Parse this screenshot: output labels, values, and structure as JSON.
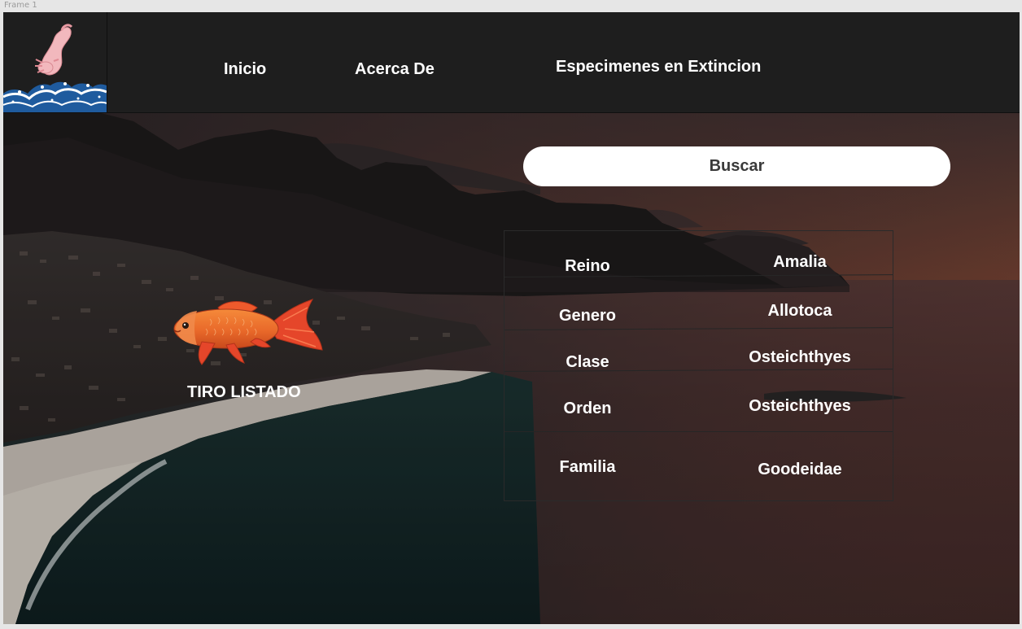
{
  "frame": {
    "label": "Frame 1"
  },
  "header": {
    "logo_icon": "axolotl-wave-logo",
    "nav": {
      "inicio": "Inicio",
      "acerca": "Acerca De",
      "especimenes": "Especimenes en Extincion"
    }
  },
  "search": {
    "label": "Buscar"
  },
  "specimen": {
    "name": "TIRO LISTADO",
    "image_icon": "goldfish-image",
    "taxonomy": [
      {
        "rank": "Reino",
        "value": "Amalia"
      },
      {
        "rank": "Genero",
        "value": "Allotoca"
      },
      {
        "rank": "Clase",
        "value": "Osteichthyes"
      },
      {
        "rank": "Orden",
        "value": "Osteichthyes"
      },
      {
        "rank": "Familia",
        "value": "Goodeidae"
      }
    ]
  },
  "colors": {
    "header_bg": "#1e1e1e",
    "text": "#ffffff",
    "search_bg": "#ffffff",
    "search_text": "#3a3a3a",
    "sunset_orange": "#b8552f"
  }
}
